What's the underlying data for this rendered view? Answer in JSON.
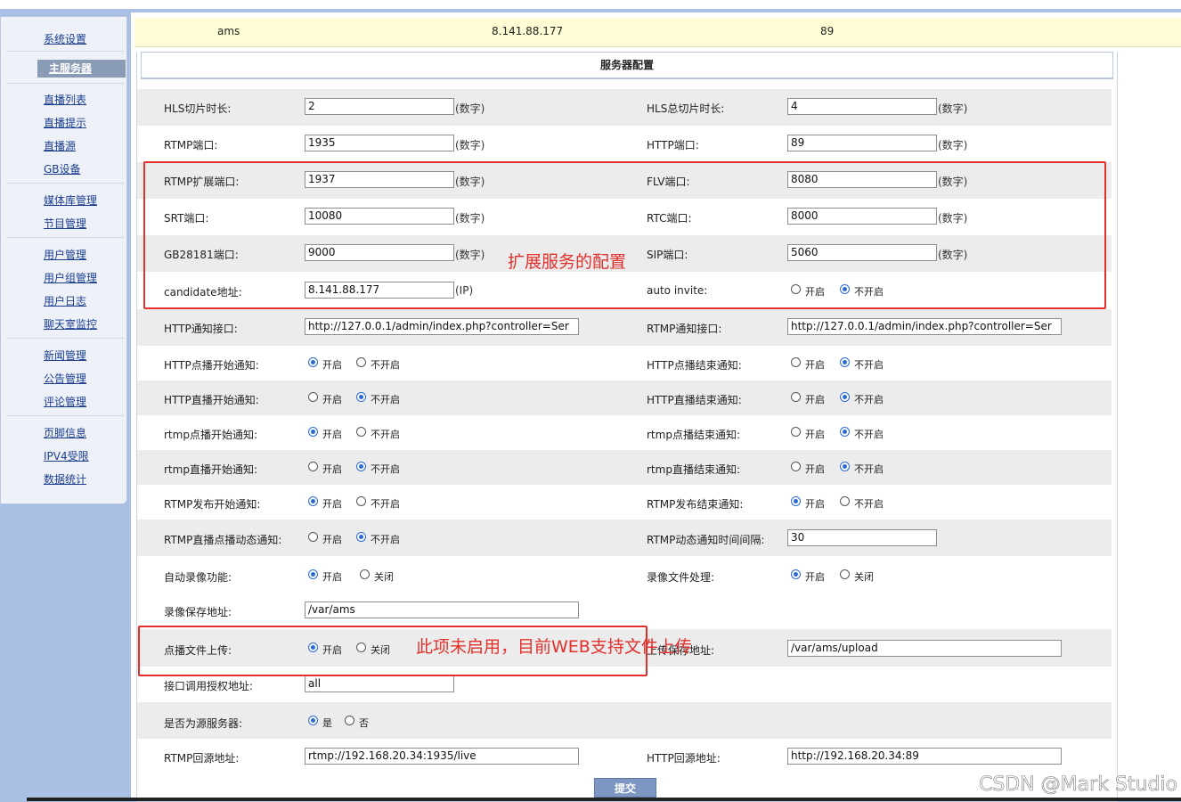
{
  "sidebar": {
    "items": [
      "系统设置",
      "主服务器",
      "直播列表",
      "直播提示",
      "直播源",
      "GB设备",
      "媒体库管理",
      "节目管理",
      "用户管理",
      "用户组管理",
      "用户日志",
      "聊天室监控",
      "新闻管理",
      "公告管理",
      "评论管理",
      "页脚信息",
      "IPV4受限",
      "数据统计"
    ],
    "active": "主服务器"
  },
  "server": {
    "name": "ams",
    "ip": "8.141.88.177",
    "port": "89"
  },
  "config_title": "服务器配置",
  "labels": {
    "hls_slice": "HLS切片时长:",
    "hls_total": "HLS总切片时长:",
    "rtmp_port": "RTMP端口:",
    "http_port": "HTTP端口:",
    "rtmp_ext_port": "RTMP扩展端口:",
    "flv_port": "FLV端口:",
    "srt_port": "SRT端口:",
    "rtc_port": "RTC端口:",
    "gb_port": "GB28181端口:",
    "sip_port": "SIP端口:",
    "candidate": "candidate地址:",
    "auto_invite": "auto invite:",
    "http_notify": "HTTP通知接口:",
    "rtmp_notify": "RTMP通知接口:",
    "http_vod_start": "HTTP点播开始通知:",
    "http_vod_end": "HTTP点播结束通知:",
    "http_live_start": "HTTP直播开始通知:",
    "http_live_end": "HTTP直播结束通知:",
    "rtmp_vod_start": "rtmp点播开始通知:",
    "rtmp_vod_end": "rtmp点播结束通知:",
    "rtmp_live_start": "rtmp直播开始通知:",
    "rtmp_live_end": "rtmp直播结束通知:",
    "rtmp_pub_start": "RTMP发布开始通知:",
    "rtmp_pub_end": "RTMP发布结束通知:",
    "rtmp_dyn": "RTMP直播点播动态通知:",
    "rtmp_dyn_interval": "RTMP动态通知时间间隔:",
    "auto_record": "自动录像功能:",
    "record_process": "录像文件处理:",
    "record_path": "录像保存地址:",
    "vod_upload": "点播文件上传:",
    "upload_path": "上传保存地址:",
    "api_auth": "接口调用授权地址:",
    "is_source": "是否为源服务器:",
    "rtmp_origin": "RTMP回源地址:",
    "http_origin": "HTTP回源地址:"
  },
  "values": {
    "hls_slice": "2",
    "hls_total": "4",
    "rtmp_port": "1935",
    "http_port": "89",
    "rtmp_ext_port": "1937",
    "flv_port": "8080",
    "srt_port": "10080",
    "rtc_port": "8000",
    "gb_port": "9000",
    "sip_port": "5060",
    "candidate": "8.141.88.177",
    "http_notify": "http://127.0.0.1/admin/index.php?controller=Ser",
    "rtmp_notify": "http://127.0.0.1/admin/index.php?controller=Ser",
    "rtmp_dyn_interval": "30",
    "record_path": "/var/ams",
    "upload_path": "/var/ams/upload",
    "api_auth": "all",
    "rtmp_origin": "rtmp://192.168.20.34:1935/live",
    "http_origin": "http://192.168.20.34:89"
  },
  "units": {
    "number": "(数字)",
    "ip": "(IP)"
  },
  "options": {
    "on": "开启",
    "off": "不开启",
    "close": "关闭",
    "yes": "是",
    "no": "否"
  },
  "annotations": {
    "ext_config": "扩展服务的配置",
    "upload_note": "此项未启用，目前WEB支持文件上传"
  },
  "submit_label": "提交",
  "watermark": "CSDN @Mark Studio",
  "colors": {
    "accent": "#2b6bd6",
    "annotation": "#e3302b",
    "serverbar": "#fffdd5"
  }
}
